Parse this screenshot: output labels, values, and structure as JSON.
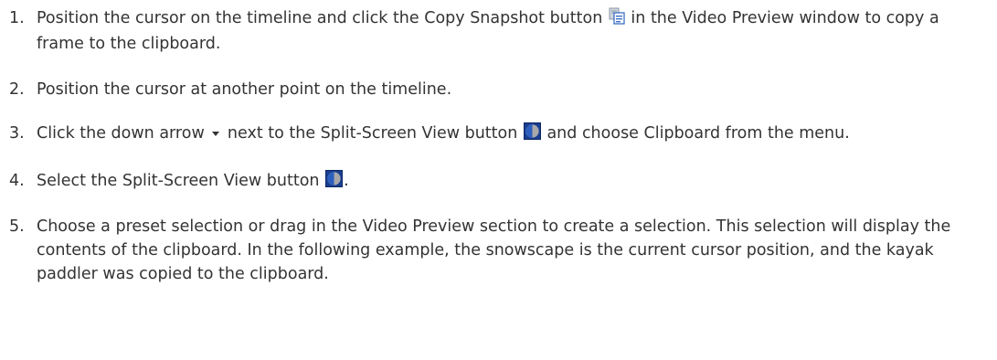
{
  "steps": [
    {
      "number": "1.",
      "text_before": "Position the cursor on the timeline and click the ",
      "ui_label": "Copy Snapshot",
      "text_mid": " button ",
      "icon": "copy-snapshot-icon",
      "text_after": " in the Video Preview window to copy a frame to the clipboard."
    },
    {
      "number": "2.",
      "text": "Position the cursor at another point on the timeline."
    },
    {
      "number": "3.",
      "text_before": "Click the down arrow ",
      "arrow_icon": "down-arrow-icon",
      "text_mid1": " next to the ",
      "ui_label1": "Split-Screen View",
      "text_mid2": " button ",
      "icon": "split-screen-view-icon",
      "text_mid3": " and choose ",
      "ui_label2": "Clipboard",
      "text_after": " from the menu."
    },
    {
      "number": "4.",
      "text_before": "Select the ",
      "ui_label": "Split-Screen View",
      "text_mid": " button ",
      "icon": "split-screen-view-icon",
      "text_after": "."
    },
    {
      "number": "5.",
      "text": "Choose a preset selection or drag in the Video Preview section to create a selection. This selection will display the contents of the clipboard. In the following example, the snowscape is the current cursor position, and the kayak paddler was copied to the clipboard."
    }
  ]
}
